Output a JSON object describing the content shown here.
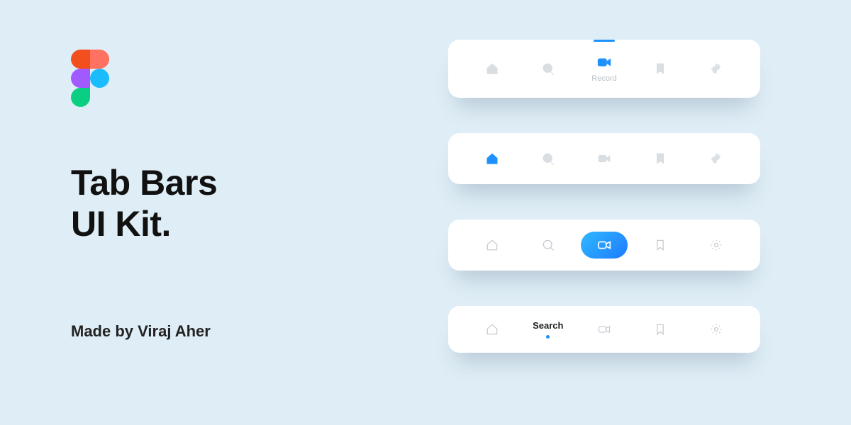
{
  "title_line1": "Tab Bars",
  "title_line2": "UI Kit.",
  "credit": "Made by Viraj Aher",
  "colors": {
    "background": "#DFEEF6",
    "accent": "#1E91FF",
    "icon_inactive": "#D9DEE3",
    "icon_outline": "#C4CBD3"
  },
  "bar1": {
    "active_index": 2,
    "active_label": "Record",
    "items": [
      "home",
      "search",
      "video",
      "bookmark",
      "settings"
    ]
  },
  "bar2": {
    "active_index": 0,
    "items": [
      "home",
      "search",
      "video",
      "bookmark",
      "settings"
    ]
  },
  "bar3": {
    "active_index": 2,
    "items": [
      "home",
      "search",
      "video",
      "bookmark",
      "settings"
    ]
  },
  "bar4": {
    "active_index": 1,
    "active_label": "Search",
    "items": [
      "home",
      "search",
      "video",
      "bookmark",
      "settings"
    ]
  }
}
